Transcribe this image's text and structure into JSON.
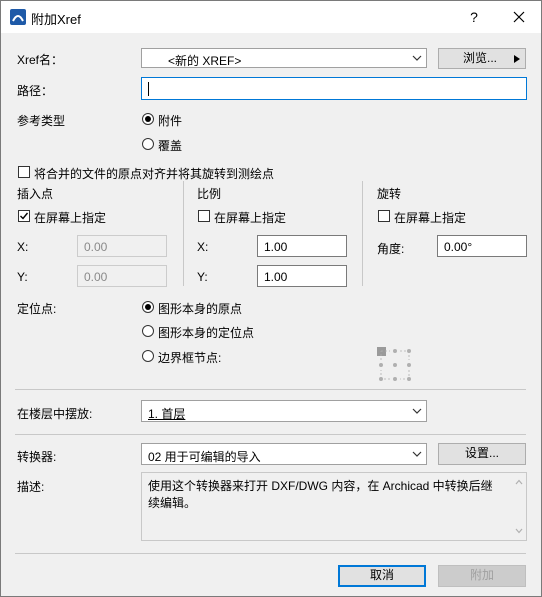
{
  "window": {
    "title": "附加Xref",
    "help": "?"
  },
  "xref_name": {
    "label": "Xref名：",
    "value": "<新的 XREF>",
    "browse": "浏览..."
  },
  "path": {
    "label": "路径：",
    "value": ""
  },
  "ref_type": {
    "label": "参考类型",
    "options": [
      "附件",
      "覆盖"
    ],
    "selected": "附件"
  },
  "align_origin": {
    "label": "将合并的文件的原点对齐并将其旋转到测绘点",
    "checked": false
  },
  "insert_point": {
    "header": "插入点",
    "on_screen": "在屏幕上指定",
    "on_screen_checked": true,
    "x_label": "X:",
    "x_value": "0.00",
    "y_label": "Y:",
    "y_value": "0.00"
  },
  "scale": {
    "header": "比例",
    "on_screen": "在屏幕上指定",
    "on_screen_checked": false,
    "x_label": "X:",
    "x_value": "1.00",
    "y_label": "Y:",
    "y_value": "1.00"
  },
  "rotation": {
    "header": "旋转",
    "on_screen": "在屏幕上指定",
    "on_screen_checked": false,
    "angle_label": "角度:",
    "angle_value": "0.00°"
  },
  "anchor": {
    "label": "定位点:",
    "options": [
      "图形本身的原点",
      "图形本身的定位点",
      "边界框节点:"
    ],
    "selected": "图形本身的原点"
  },
  "story": {
    "label": "在楼层中摆放:",
    "value": "1. 首层"
  },
  "translator": {
    "label": "转换器:",
    "value": "02 用于可编辑的导入",
    "settings": "设置..."
  },
  "description": {
    "label": "描述:",
    "text": "使用这个转换器来打开 DXF/DWG 内容，在 Archicad 中转换后继续编辑。"
  },
  "footer": {
    "cancel": "取消",
    "attach": "附加"
  },
  "colors": {
    "accent": "#0078d7",
    "disabled_text": "#a0a0a0",
    "dialog_bg": "#f0f0f0"
  }
}
